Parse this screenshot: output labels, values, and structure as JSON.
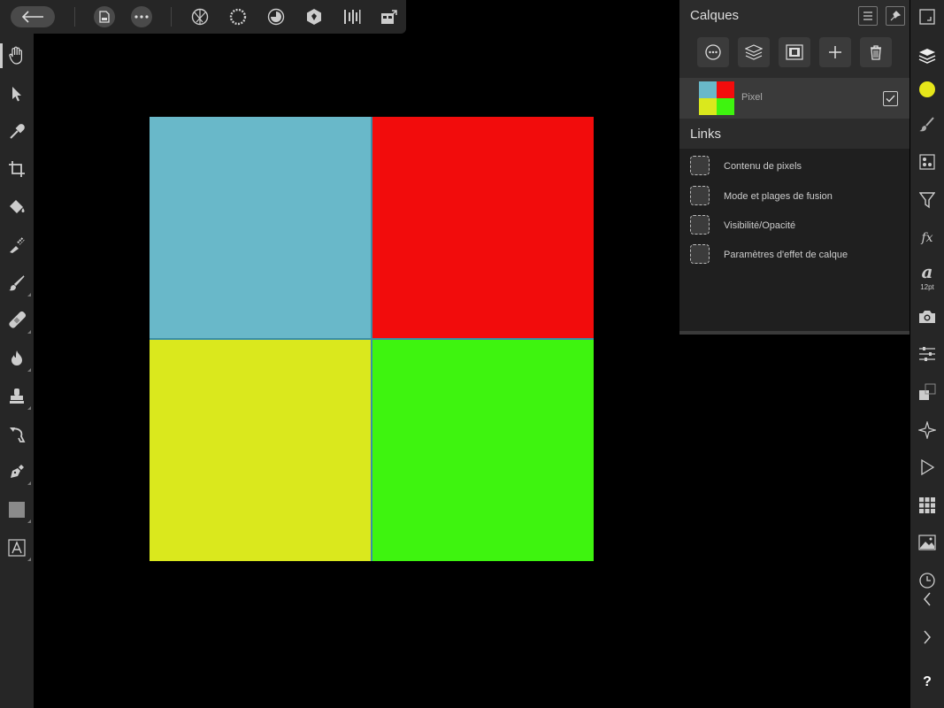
{
  "layers_panel": {
    "title": "Calques",
    "layer": {
      "name": "Pixel",
      "checked": true
    }
  },
  "links_panel": {
    "title": "Links",
    "items": [
      {
        "label": "Contenu de pixels"
      },
      {
        "label": "Mode et plages de fusion"
      },
      {
        "label": "Visibilité/Opacité"
      },
      {
        "label": "Paramètres d'effet de calque"
      }
    ]
  },
  "studio": {
    "font_size": "12pt",
    "help": "?",
    "fx": "fx",
    "char": "a"
  },
  "canvas": {
    "colors": {
      "top_left": "#69b8c9",
      "top_right": "#f20c0c",
      "bottom_left": "#dae81d",
      "bottom_right": "#3ef40f"
    }
  },
  "colors": {
    "primary_color_swatch": "#e6e61a",
    "panel_bg": "#1f1f1f",
    "toolbar_bg": "#262626"
  }
}
